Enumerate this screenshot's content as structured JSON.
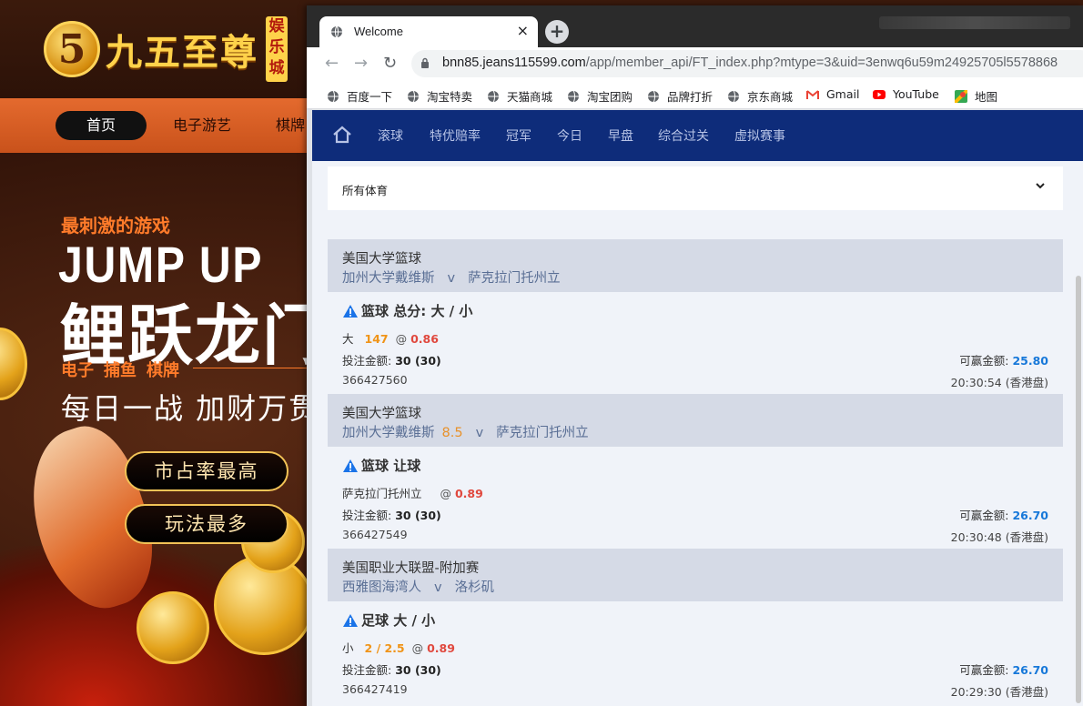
{
  "background_site": {
    "logo_digit": "5",
    "logo_text": "九五至尊",
    "logo_badge": "娱乐城",
    "nav": [
      "首页",
      "电子游艺",
      "棋牌"
    ],
    "hero_sub": "最刺激的游戏",
    "hero_en": "JUMP UP",
    "hero_cn": "鲤跃龙门",
    "hero_tags": "电子 捕鱼 棋牌",
    "hero_slogan": "每日一战 加财万贯",
    "pill_1": "市占率最高",
    "pill_2": "玩法最多"
  },
  "browser": {
    "tab_title": "Welcome",
    "tab_close": "×",
    "new_tab": "+",
    "url_host": "bnn85.jeans115599.com",
    "url_path": "/app/member_api/FT_index.php?mtype=3&uid=3enwq6u59m24925705l5578868",
    "bookmarks": [
      {
        "label": "百度一下",
        "icon": "globe-icon"
      },
      {
        "label": "淘宝特卖",
        "icon": "globe-icon"
      },
      {
        "label": "天猫商城",
        "icon": "globe-icon"
      },
      {
        "label": "淘宝团购",
        "icon": "globe-icon"
      },
      {
        "label": "品牌打折",
        "icon": "globe-icon"
      },
      {
        "label": "京东商城",
        "icon": "globe-icon"
      },
      {
        "label": "Gmail",
        "icon": "gmail-icon"
      },
      {
        "label": "YouTube",
        "icon": "youtube-icon"
      },
      {
        "label": "地图",
        "icon": "maps-icon"
      }
    ]
  },
  "sports_nav": [
    "滚球",
    "特优赔率",
    "冠军",
    "今日",
    "早盘",
    "综合过关",
    "虚拟赛事"
  ],
  "filter_label": "所有体育",
  "bets": [
    {
      "league": "美国大学篮球",
      "home": "加州大学戴维斯",
      "handicap": "",
      "vs": "v",
      "away": "萨克拉门托州立",
      "market": "篮球 总分: 大 / 小",
      "pick": "大",
      "line": "147",
      "at": "@",
      "odds": "0.86",
      "stake_label": "投注金额:",
      "stake": "30 (30)",
      "win_label": "可赢金额:",
      "win": "25.80",
      "ticket": "366427560",
      "time": "20:30:54 (香港盘)"
    },
    {
      "league": "美国大学篮球",
      "home": "加州大学戴维斯",
      "handicap": "8.5",
      "vs": "v",
      "away": "萨克拉门托州立",
      "market": "篮球 让球",
      "pick": "萨克拉门托州立",
      "line": "",
      "at": "@",
      "odds": "0.89",
      "stake_label": "投注金额:",
      "stake": "30 (30)",
      "win_label": "可赢金额:",
      "win": "26.70",
      "ticket": "366427549",
      "time": "20:30:48 (香港盘)"
    },
    {
      "league": "美国职业大联盟-附加赛",
      "home": "西雅图海湾人",
      "handicap": "",
      "vs": "v",
      "away": "洛杉矶",
      "market": "足球 大 / 小",
      "pick": "小",
      "line": "2 / 2.5",
      "at": "@",
      "odds": "0.89",
      "stake_label": "投注金额:",
      "stake": "30 (30)",
      "win_label": "可赢金额:",
      "win": "26.70",
      "ticket": "366427419",
      "time": "20:29:30 (香港盘)"
    }
  ],
  "colors": {
    "nav_bg": "#0e2c7a",
    "odds": "#e0483e",
    "line": "#f09418",
    "win": "#1778d9"
  }
}
